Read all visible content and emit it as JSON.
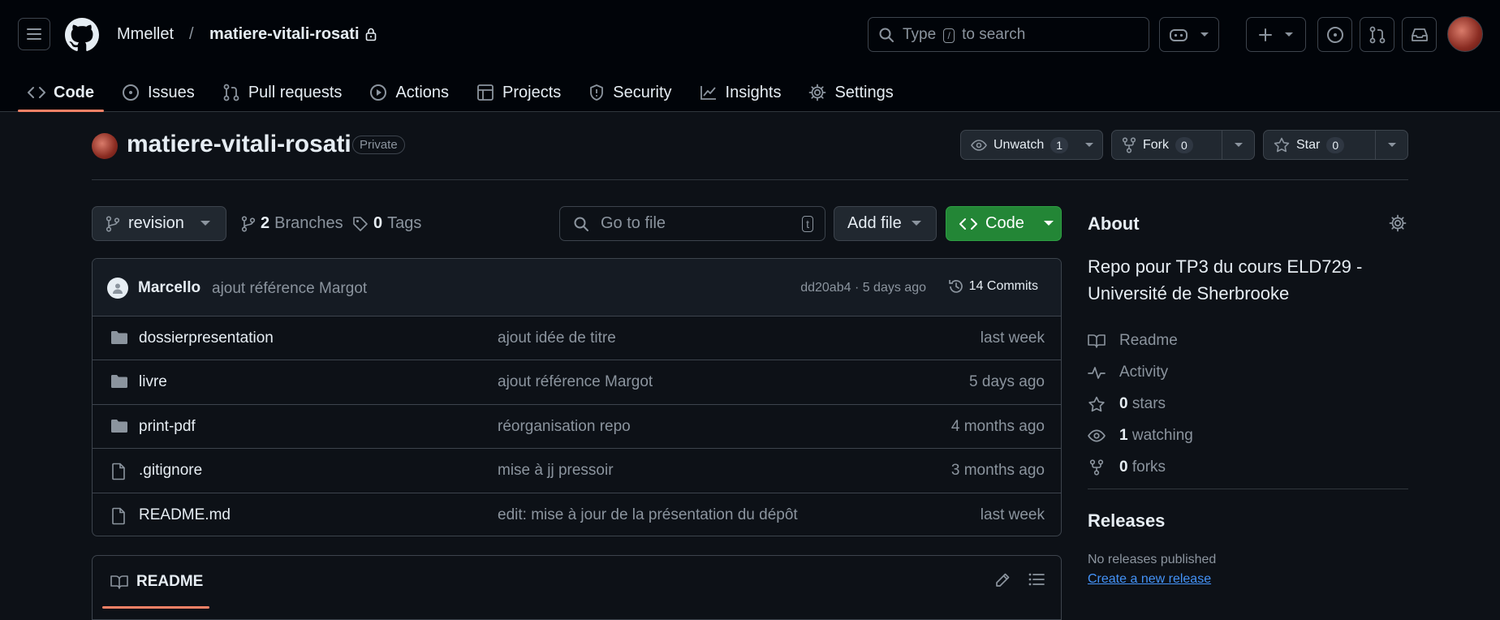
{
  "header": {
    "owner": "Mmellet",
    "separator": "/",
    "repo": "matiere-vitali-rosati",
    "search_prefix": "Type",
    "search_key": "/",
    "search_suffix": "to search"
  },
  "nav": {
    "tabs": [
      {
        "label": "Code",
        "icon": "code-icon"
      },
      {
        "label": "Issues",
        "icon": "issue-icon"
      },
      {
        "label": "Pull requests",
        "icon": "pull-request-icon"
      },
      {
        "label": "Actions",
        "icon": "play-icon"
      },
      {
        "label": "Projects",
        "icon": "table-icon"
      },
      {
        "label": "Security",
        "icon": "shield-icon"
      },
      {
        "label": "Insights",
        "icon": "graph-icon"
      },
      {
        "label": "Settings",
        "icon": "gear-icon"
      }
    ]
  },
  "repo": {
    "title": "matiere-vitali-rosati",
    "visibility": "Private",
    "unwatch_label": "Unwatch",
    "watch_count": "1",
    "fork_label": "Fork",
    "fork_count": "0",
    "star_label": "Star",
    "star_count": "0"
  },
  "toolbar": {
    "branch": "revision",
    "branches_count": "2",
    "branches_label": "Branches",
    "tags_count": "0",
    "tags_label": "Tags",
    "go_to_file_placeholder": "Go to file",
    "go_to_file_key": "t",
    "add_file_label": "Add file",
    "code_label": "Code"
  },
  "commit": {
    "author": "Marcello",
    "message": "ajout référence Margot",
    "sha_time": "dd20ab4 · 5 days ago",
    "commits_label": "14 Commits"
  },
  "files": [
    {
      "type": "folder",
      "name": "dossierpresentation",
      "message": "ajout idée de titre",
      "date": "last week"
    },
    {
      "type": "folder",
      "name": "livre",
      "message": "ajout référence Margot",
      "date": "5 days ago"
    },
    {
      "type": "folder",
      "name": "print-pdf",
      "message": "réorganisation repo",
      "date": "4 months ago"
    },
    {
      "type": "file",
      "name": ".gitignore",
      "message": "mise à jj pressoir",
      "date": "3 months ago"
    },
    {
      "type": "file",
      "name": "README.md",
      "message": "edit: mise à jour de la présentation du dépôt",
      "date": "last week"
    }
  ],
  "readme": {
    "tab_label": "README"
  },
  "about": {
    "title": "About",
    "description": "Repo pour TP3 du cours ELD729 - Université de Sherbrooke",
    "readme_label": "Readme",
    "activity_label": "Activity",
    "stars_count": "0",
    "stars_label": "stars",
    "watching_count": "1",
    "watching_label": "watching",
    "forks_count": "0",
    "forks_label": "forks"
  },
  "releases": {
    "title": "Releases",
    "none_text": "No releases published",
    "create_link": "Create a new release"
  },
  "colors": {
    "background": "#0d1117",
    "header_bg": "#010409",
    "accent_underline": "#f78166",
    "primary_button": "#238636",
    "link": "#4493f8"
  }
}
